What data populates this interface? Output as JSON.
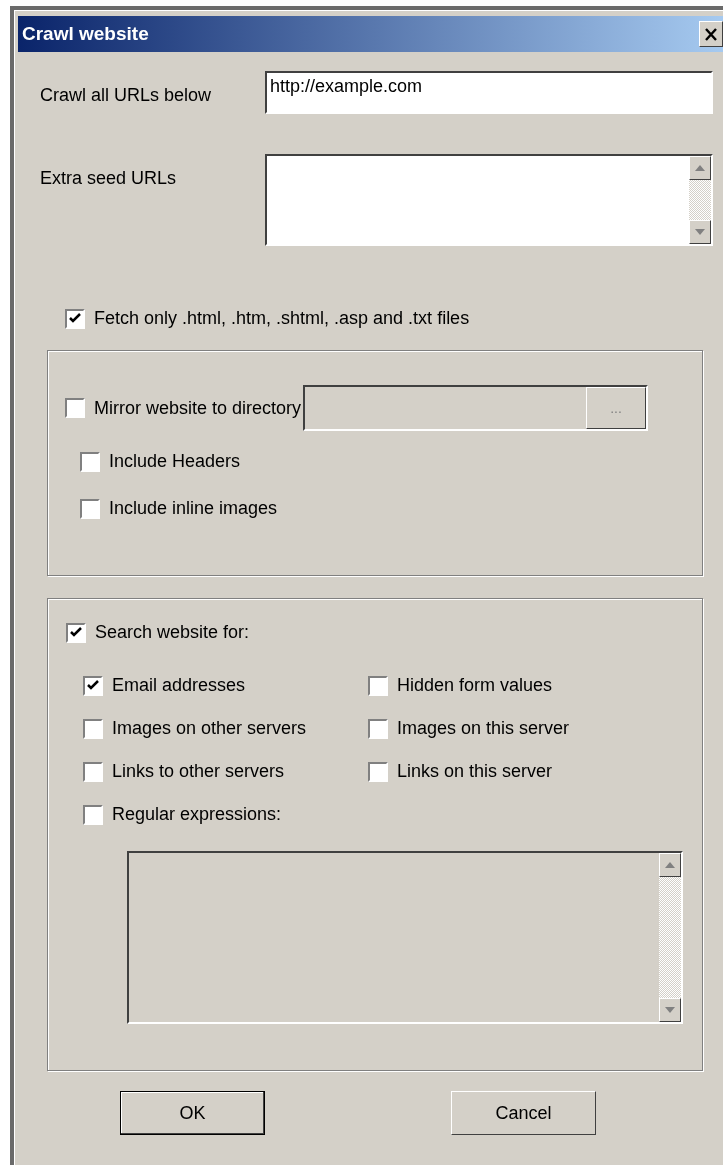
{
  "window": {
    "title": "Crawl website"
  },
  "crawl_urls": {
    "label": "Crawl all URLs below",
    "value": "http://example.com"
  },
  "extra_seed_urls": {
    "label": "Extra seed URLs"
  },
  "fetch_only": {
    "label": "Fetch only .html, .htm, .shtml, .asp and .txt files",
    "checked": true
  },
  "mirror": {
    "label": "Mirror website to directory",
    "checked": false,
    "directory_disabled": true,
    "browse": "...",
    "options": [
      {
        "label": "Include Headers",
        "checked": false
      },
      {
        "label": "Include inline images",
        "checked": false
      }
    ]
  },
  "search": {
    "label": "Search website for:",
    "checked": true,
    "options": [
      {
        "label": "Email addresses",
        "checked": true
      },
      {
        "label": "Hidden form values",
        "checked": false
      },
      {
        "label": "Images on other servers",
        "checked": false
      },
      {
        "label": "Images on this server",
        "checked": false
      },
      {
        "label": "Links to other servers",
        "checked": false
      },
      {
        "label": "Links on this server",
        "checked": false
      }
    ],
    "regex": {
      "label": "Regular expressions:",
      "checked": false,
      "disabled": true
    }
  },
  "buttons": [
    {
      "label": "OK",
      "default": true
    },
    {
      "label": "Cancel",
      "default": false
    }
  ]
}
